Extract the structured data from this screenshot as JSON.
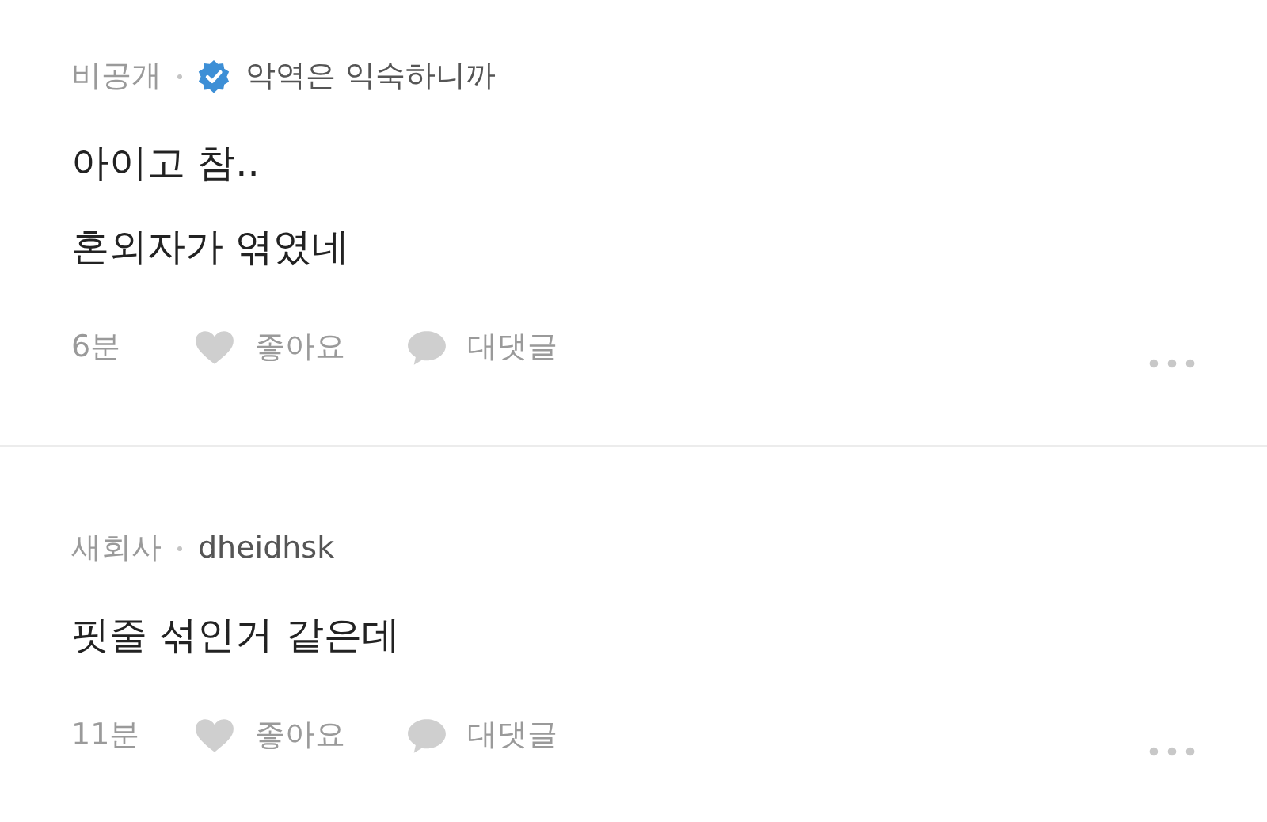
{
  "comments": [
    {
      "company": "비공개",
      "verified": true,
      "author": "악역은 익숙하니까",
      "lines": [
        "아이고 참..",
        "혼외자가 엮였네"
      ],
      "time": "6분",
      "like_label": "좋아요",
      "reply_label": "대댓글"
    },
    {
      "company": "새회사",
      "verified": false,
      "author": "dheidhsk",
      "lines": [
        "핏줄 섞인거 같은데"
      ],
      "time": "11분",
      "like_label": "좋아요",
      "reply_label": "대댓글"
    }
  ]
}
